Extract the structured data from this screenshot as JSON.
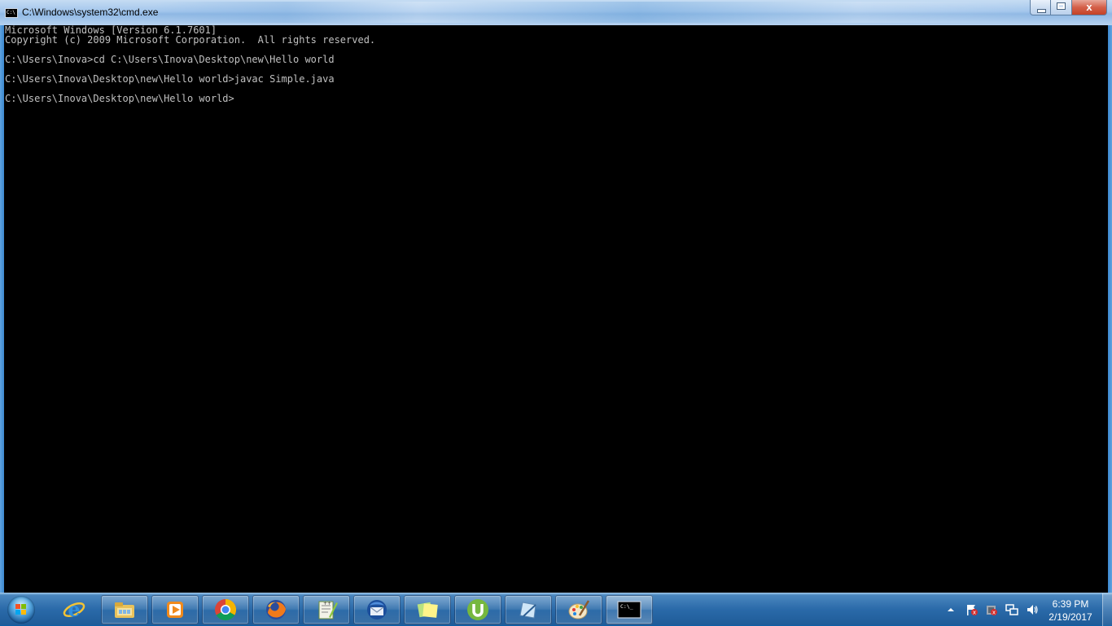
{
  "window": {
    "title": "C:\\Windows\\system32\\cmd.exe",
    "icon": "cmd-icon",
    "controls": {
      "minimize": "minimize-icon",
      "maximize": "maximize-icon",
      "close": "close-icon"
    },
    "close_glyph": "x"
  },
  "console": {
    "lines": [
      "Microsoft Windows [Version 6.1.7601]",
      "Copyright (c) 2009 Microsoft Corporation.  All rights reserved.",
      "",
      "C:\\Users\\Inova>cd C:\\Users\\Inova\\Desktop\\new\\Hello world",
      "",
      "C:\\Users\\Inova\\Desktop\\new\\Hello world>javac Simple.java",
      "",
      "C:\\Users\\Inova\\Desktop\\new\\Hello world>"
    ],
    "text_color": "#c0c0c0",
    "background": "#000000"
  },
  "taskbar": {
    "start_icon": "windows-start-orb-icon",
    "pinned": [
      {
        "name": "internet-explorer-icon",
        "style": "plain"
      },
      {
        "name": "file-explorer-icon",
        "style": "button"
      },
      {
        "name": "media-player-icon",
        "style": "button"
      },
      {
        "name": "chrome-icon",
        "style": "button"
      },
      {
        "name": "firefox-icon",
        "style": "button"
      },
      {
        "name": "notepad-plus-plus-icon",
        "style": "button"
      },
      {
        "name": "thunderbird-icon",
        "style": "button"
      },
      {
        "name": "sticky-notes-icon",
        "style": "button"
      },
      {
        "name": "utorrent-icon",
        "style": "button"
      },
      {
        "name": "snipping-tool-icon",
        "style": "button"
      },
      {
        "name": "paint-icon",
        "style": "button"
      },
      {
        "name": "command-prompt-icon",
        "style": "active"
      }
    ],
    "cmd_button_glyph": "C:\\_",
    "tray": {
      "icons": [
        "show-hidden-icons-arrow-icon",
        "action-center-flag-icon",
        "security-warning-icon",
        "network-icon",
        "volume-icon"
      ],
      "time": "6:39 PM",
      "date": "2/19/2017"
    }
  }
}
